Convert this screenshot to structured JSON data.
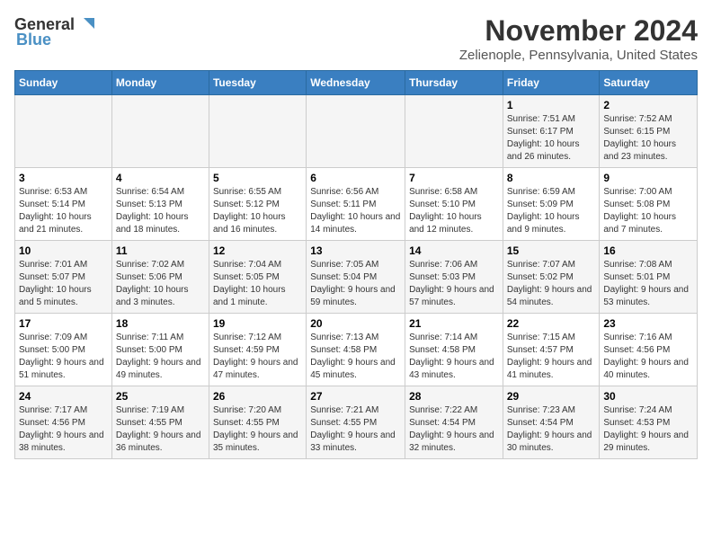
{
  "header": {
    "logo_general": "General",
    "logo_blue": "Blue",
    "month_title": "November 2024",
    "location": "Zelienople, Pennsylvania, United States"
  },
  "days_of_week": [
    "Sunday",
    "Monday",
    "Tuesday",
    "Wednesday",
    "Thursday",
    "Friday",
    "Saturday"
  ],
  "weeks": [
    [
      {
        "day": "",
        "info": ""
      },
      {
        "day": "",
        "info": ""
      },
      {
        "day": "",
        "info": ""
      },
      {
        "day": "",
        "info": ""
      },
      {
        "day": "",
        "info": ""
      },
      {
        "day": "1",
        "info": "Sunrise: 7:51 AM\nSunset: 6:17 PM\nDaylight: 10 hours and 26 minutes."
      },
      {
        "day": "2",
        "info": "Sunrise: 7:52 AM\nSunset: 6:15 PM\nDaylight: 10 hours and 23 minutes."
      }
    ],
    [
      {
        "day": "3",
        "info": "Sunrise: 6:53 AM\nSunset: 5:14 PM\nDaylight: 10 hours and 21 minutes."
      },
      {
        "day": "4",
        "info": "Sunrise: 6:54 AM\nSunset: 5:13 PM\nDaylight: 10 hours and 18 minutes."
      },
      {
        "day": "5",
        "info": "Sunrise: 6:55 AM\nSunset: 5:12 PM\nDaylight: 10 hours and 16 minutes."
      },
      {
        "day": "6",
        "info": "Sunrise: 6:56 AM\nSunset: 5:11 PM\nDaylight: 10 hours and 14 minutes."
      },
      {
        "day": "7",
        "info": "Sunrise: 6:58 AM\nSunset: 5:10 PM\nDaylight: 10 hours and 12 minutes."
      },
      {
        "day": "8",
        "info": "Sunrise: 6:59 AM\nSunset: 5:09 PM\nDaylight: 10 hours and 9 minutes."
      },
      {
        "day": "9",
        "info": "Sunrise: 7:00 AM\nSunset: 5:08 PM\nDaylight: 10 hours and 7 minutes."
      }
    ],
    [
      {
        "day": "10",
        "info": "Sunrise: 7:01 AM\nSunset: 5:07 PM\nDaylight: 10 hours and 5 minutes."
      },
      {
        "day": "11",
        "info": "Sunrise: 7:02 AM\nSunset: 5:06 PM\nDaylight: 10 hours and 3 minutes."
      },
      {
        "day": "12",
        "info": "Sunrise: 7:04 AM\nSunset: 5:05 PM\nDaylight: 10 hours and 1 minute."
      },
      {
        "day": "13",
        "info": "Sunrise: 7:05 AM\nSunset: 5:04 PM\nDaylight: 9 hours and 59 minutes."
      },
      {
        "day": "14",
        "info": "Sunrise: 7:06 AM\nSunset: 5:03 PM\nDaylight: 9 hours and 57 minutes."
      },
      {
        "day": "15",
        "info": "Sunrise: 7:07 AM\nSunset: 5:02 PM\nDaylight: 9 hours and 54 minutes."
      },
      {
        "day": "16",
        "info": "Sunrise: 7:08 AM\nSunset: 5:01 PM\nDaylight: 9 hours and 53 minutes."
      }
    ],
    [
      {
        "day": "17",
        "info": "Sunrise: 7:09 AM\nSunset: 5:00 PM\nDaylight: 9 hours and 51 minutes."
      },
      {
        "day": "18",
        "info": "Sunrise: 7:11 AM\nSunset: 5:00 PM\nDaylight: 9 hours and 49 minutes."
      },
      {
        "day": "19",
        "info": "Sunrise: 7:12 AM\nSunset: 4:59 PM\nDaylight: 9 hours and 47 minutes."
      },
      {
        "day": "20",
        "info": "Sunrise: 7:13 AM\nSunset: 4:58 PM\nDaylight: 9 hours and 45 minutes."
      },
      {
        "day": "21",
        "info": "Sunrise: 7:14 AM\nSunset: 4:58 PM\nDaylight: 9 hours and 43 minutes."
      },
      {
        "day": "22",
        "info": "Sunrise: 7:15 AM\nSunset: 4:57 PM\nDaylight: 9 hours and 41 minutes."
      },
      {
        "day": "23",
        "info": "Sunrise: 7:16 AM\nSunset: 4:56 PM\nDaylight: 9 hours and 40 minutes."
      }
    ],
    [
      {
        "day": "24",
        "info": "Sunrise: 7:17 AM\nSunset: 4:56 PM\nDaylight: 9 hours and 38 minutes."
      },
      {
        "day": "25",
        "info": "Sunrise: 7:19 AM\nSunset: 4:55 PM\nDaylight: 9 hours and 36 minutes."
      },
      {
        "day": "26",
        "info": "Sunrise: 7:20 AM\nSunset: 4:55 PM\nDaylight: 9 hours and 35 minutes."
      },
      {
        "day": "27",
        "info": "Sunrise: 7:21 AM\nSunset: 4:55 PM\nDaylight: 9 hours and 33 minutes."
      },
      {
        "day": "28",
        "info": "Sunrise: 7:22 AM\nSunset: 4:54 PM\nDaylight: 9 hours and 32 minutes."
      },
      {
        "day": "29",
        "info": "Sunrise: 7:23 AM\nSunset: 4:54 PM\nDaylight: 9 hours and 30 minutes."
      },
      {
        "day": "30",
        "info": "Sunrise: 7:24 AM\nSunset: 4:53 PM\nDaylight: 9 hours and 29 minutes."
      }
    ]
  ]
}
